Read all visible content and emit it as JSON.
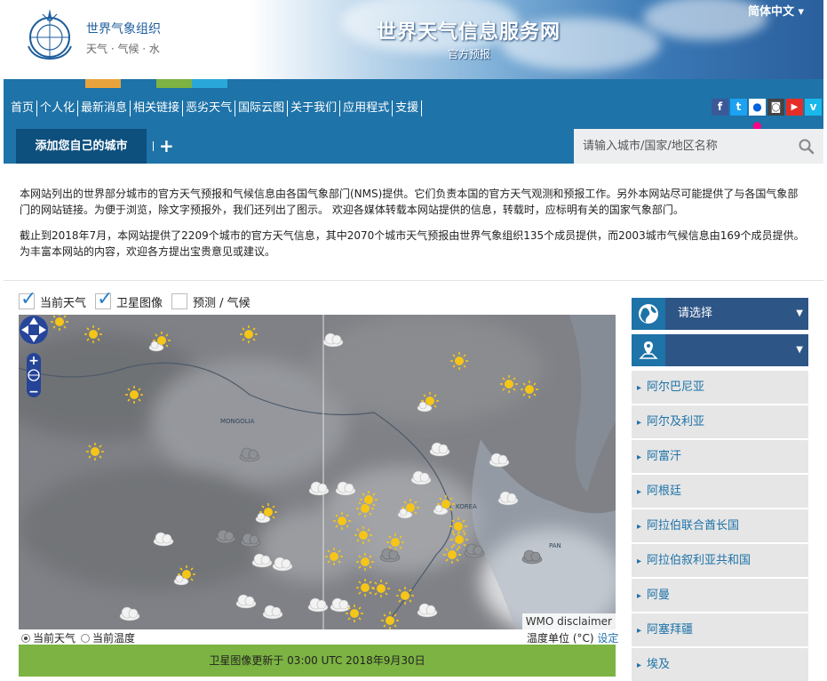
{
  "header": {
    "org_name": "世界气象组织",
    "org_sub": "天气 · 气候 · 水",
    "site_title": "世界天气信息服务网",
    "site_subtitle": "官方预报",
    "language": "简体中文",
    "color_stripes": [
      "#e8a33d",
      "#1e73a8",
      "#7cb342",
      "#2aa7d9"
    ]
  },
  "nav": {
    "items": [
      "首页",
      "个人化",
      "最新消息",
      "相关链接",
      "恶劣天气",
      "国际云图",
      "关于我们",
      "应用程式",
      "支援"
    ],
    "social": [
      {
        "icon": "facebook-icon",
        "glyph": "f",
        "color": "#3b5998"
      },
      {
        "icon": "twitter-icon",
        "glyph": "t",
        "color": "#1da1f2"
      },
      {
        "icon": "flickr-icon",
        "glyph": "●●",
        "color": "#222222"
      },
      {
        "icon": "instagram-icon",
        "glyph": "◙",
        "color": "#444444"
      },
      {
        "icon": "youtube-icon",
        "glyph": "▶",
        "color": "#e52d27"
      },
      {
        "icon": "vimeo-icon",
        "glyph": "v",
        "color": "#1ab7ea"
      }
    ]
  },
  "citybar": {
    "add_city": "添加您自己的城市",
    "add_plus": "+",
    "search_placeholder": "请输入城市/国家/地区名称"
  },
  "intro": {
    "p1": "本网站列出的世界部分城市的官方天气预报和气候信息由各国气象部门(NMS)提供。它们负责本国的官方天气观测和预报工作。另外本网站尽可能提供了与各国气象部门的网站链接。为便于浏览，除文字预报外，我们还列出了图示。 欢迎各媒体转载本网站提供的信息，转载时，应标明有关的国家气象部门。",
    "p2": "截止到2018年7月，本网站提供了2209个城市的官方天气信息，其中2070个城市天气预报由世界气象组织135个成员提供，而2003城市气候信息由169个成员提供。为丰富本网站的内容，欢迎各方提出宝贵意见或建议。"
  },
  "layers": [
    {
      "label": "当前天气",
      "checked": true
    },
    {
      "label": "卫星图像",
      "checked": true
    },
    {
      "label": "预测 / 气候",
      "checked": false
    }
  ],
  "map": {
    "labels": {
      "mongolia": "MONGOLIA",
      "korea": "KOREA",
      "japan": "PAN"
    },
    "disclaimer": "WMO disclaimer"
  },
  "radios": [
    {
      "label": "当前天气",
      "selected": true
    },
    {
      "label": "当前温度",
      "selected": false
    }
  ],
  "temp_unit": {
    "text": "温度单位 (°C) ",
    "link": "设定"
  },
  "update_text": "卫星图像更新于 03:00 UTC 2018年9月30日",
  "sidebar": {
    "select1": "请选择",
    "select2": "",
    "countries": [
      "阿尔巴尼亚",
      "阿尔及利亚",
      "阿富汗",
      "阿根廷",
      "阿拉伯联合酋长国",
      "阿拉伯叙利亚共和国",
      "阿曼",
      "阿塞拜疆",
      "埃及"
    ]
  }
}
